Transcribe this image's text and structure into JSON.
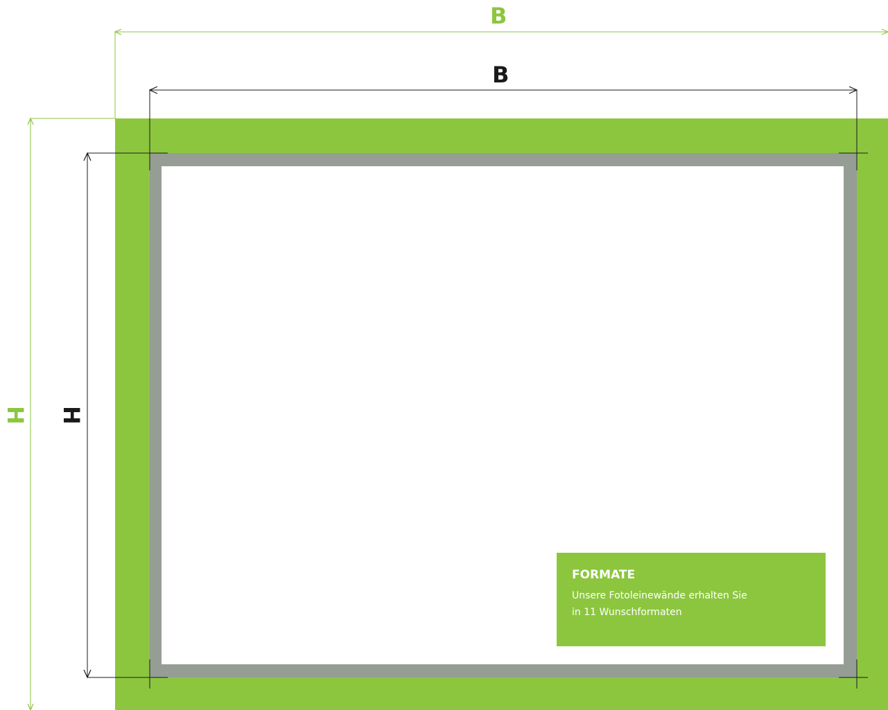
{
  "labels": {
    "outer_width": "B",
    "inner_width": "B",
    "outer_height": "H",
    "inner_height": "H"
  },
  "info": {
    "title": "FORMATE",
    "line1": "Unsere Fotoleinewände erhalten Sie",
    "line2": "in 11 Wunschformaten"
  },
  "colors": {
    "green": "#8cc63f",
    "frame_gray": "#959d95",
    "line_dark": "#1a1a1a"
  }
}
